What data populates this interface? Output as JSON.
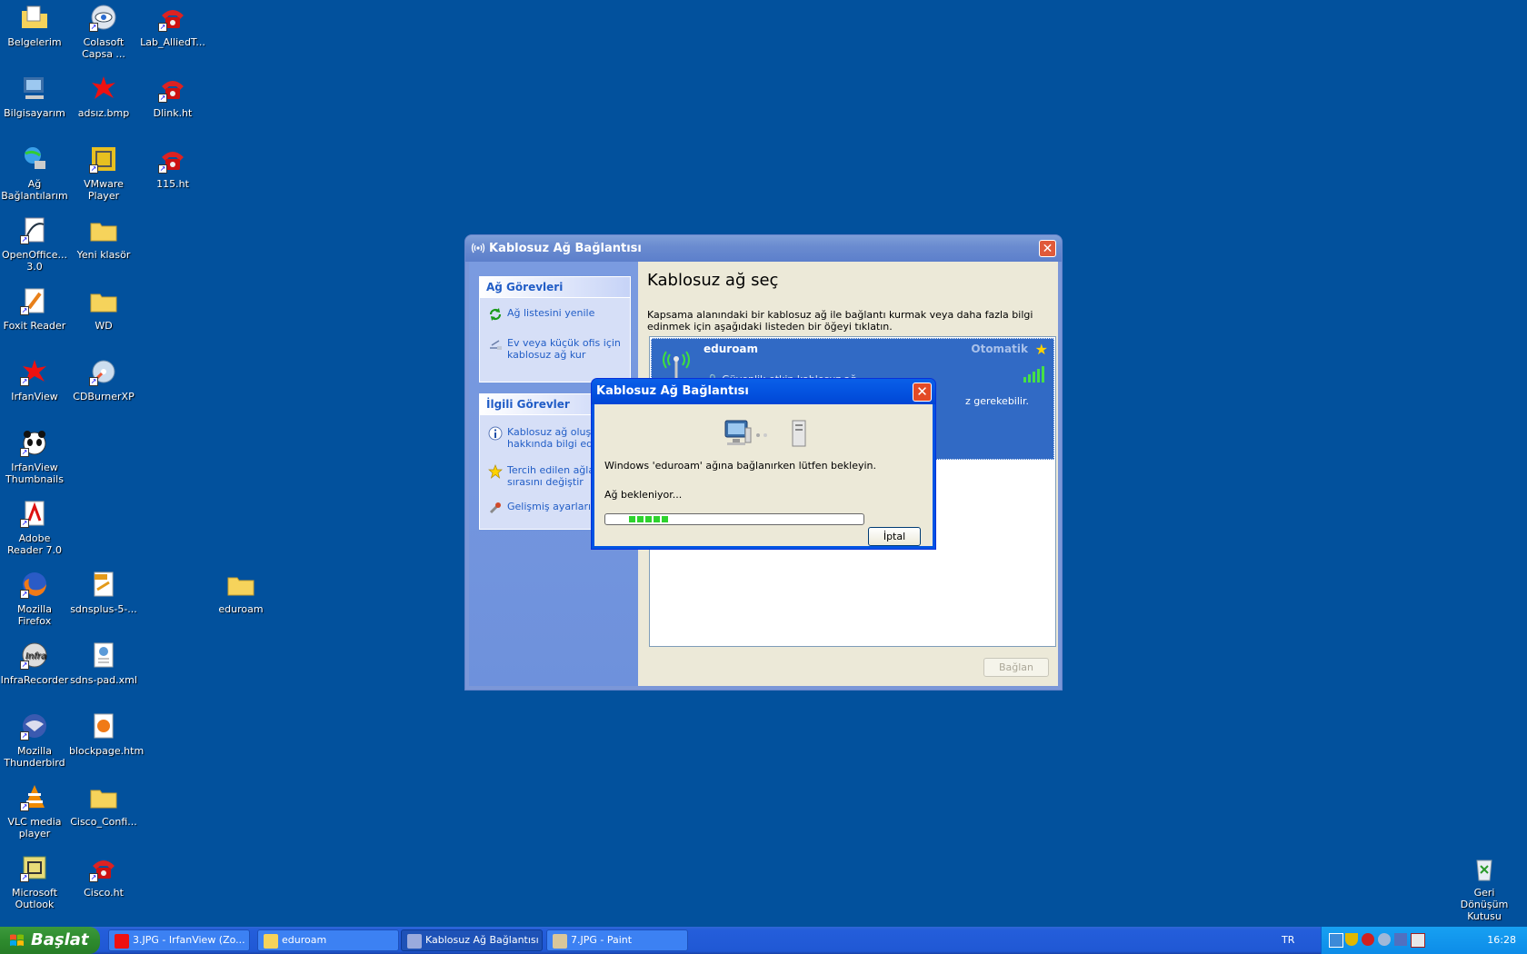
{
  "desktop": {
    "icons": [
      {
        "label": "Belgelerim",
        "icon": "my-documents-icon"
      },
      {
        "label": "Colasoft Capsa ...",
        "icon": "capsa-icon"
      },
      {
        "label": "Lab_AlliedT...",
        "icon": "phone-shortcut-icon"
      },
      {
        "label": "Bilgisayarım",
        "icon": "my-computer-icon"
      },
      {
        "label": "adsız.bmp",
        "icon": "bmp-icon"
      },
      {
        "label": "Dlink.ht",
        "icon": "phone-shortcut-icon"
      },
      {
        "label": "Ağ Bağlantılarım",
        "icon": "network-icon"
      },
      {
        "label": "VMware Player",
        "icon": "vmware-icon"
      },
      {
        "label": "115.ht",
        "icon": "phone-shortcut-icon"
      },
      {
        "label": "OpenOffice... 3.0",
        "icon": "openoffice-icon"
      },
      {
        "label": "Yeni klasör",
        "icon": "folder-icon"
      },
      {
        "label": "Foxit Reader",
        "icon": "foxit-icon"
      },
      {
        "label": "WD",
        "icon": "folder-icon"
      },
      {
        "label": "IrfanView",
        "icon": "irfanview-icon"
      },
      {
        "label": "CDBurnerXP",
        "icon": "cdburner-icon"
      },
      {
        "label": "IrfanView Thumbnails",
        "icon": "panda-icon"
      },
      {
        "label": "Adobe Reader 7.0",
        "icon": "adobe-icon"
      },
      {
        "label": "Mozilla Firefox",
        "icon": "firefox-icon"
      },
      {
        "label": "sdnsplus-5-...",
        "icon": "pdf-icon"
      },
      {
        "label": "eduroam",
        "icon": "folder-icon"
      },
      {
        "label": "InfraRecorder",
        "icon": "infrarecorder-icon"
      },
      {
        "label": "sdns-pad.xml",
        "icon": "xml-icon"
      },
      {
        "label": "Mozilla Thunderbird",
        "icon": "thunderbird-icon"
      },
      {
        "label": "blockpage.htm",
        "icon": "htm-icon"
      },
      {
        "label": "VLC media player",
        "icon": "vlc-icon"
      },
      {
        "label": "Cisco_Confi...",
        "icon": "folder-icon"
      },
      {
        "label": "Microsoft Outlook",
        "icon": "outlook-icon"
      },
      {
        "label": "Cisco.ht",
        "icon": "phone-shortcut-icon"
      },
      {
        "label": "Geri Dönüşüm Kutusu",
        "icon": "recycle-bin-icon"
      }
    ]
  },
  "main_window": {
    "title": "Kablosuz Ağ Bağlantısı",
    "tasks_title": "Ağ Görevleri",
    "tasks": [
      "Ağ listesini yenile",
      "Ev veya küçük ofis için kablosuz ağ kur"
    ],
    "related_title": "İlgili Görevler",
    "related": [
      "Kablosuz ağ oluşturma hakkında bilgi edin",
      "Tercih edilen ağların sırasını değiştir",
      "Gelişmiş ayarları değiştir"
    ],
    "heading": "Kablosuz ağ seç",
    "description": "Kapsama alanındaki bir kablosuz ağ ile bağlantı kurmak veya daha fazla bilgi edinmek için aşağıdaki listeden bir öğeyi tıklatın.",
    "network": {
      "name": "eduroam",
      "mode": "Otomatik",
      "security": "Güvenlik etkin kablosuz ağ",
      "fragment": "z gerekebilir."
    },
    "connect_label": "Bağlan"
  },
  "dialog": {
    "title": "Kablosuz Ağ Bağlantısı",
    "message": "Windows 'eduroam' ağına bağlanırken lütfen bekleyin.",
    "status": "Ağ bekleniyor...",
    "progress_blocks": 5,
    "cancel_label": "İptal"
  },
  "taskbar": {
    "start_label": "Başlat",
    "buttons": [
      {
        "label": "3.JPG - IrfanView (Zo...",
        "icon": "irfanview-icon"
      },
      {
        "label": "eduroam",
        "icon": "folder-icon"
      },
      {
        "label": "Kablosuz Ağ Bağlantısı",
        "icon": "wireless-icon"
      },
      {
        "label": "7.JPG - Paint",
        "icon": "paint-icon"
      }
    ],
    "language": "TR",
    "clock": "16:28"
  }
}
